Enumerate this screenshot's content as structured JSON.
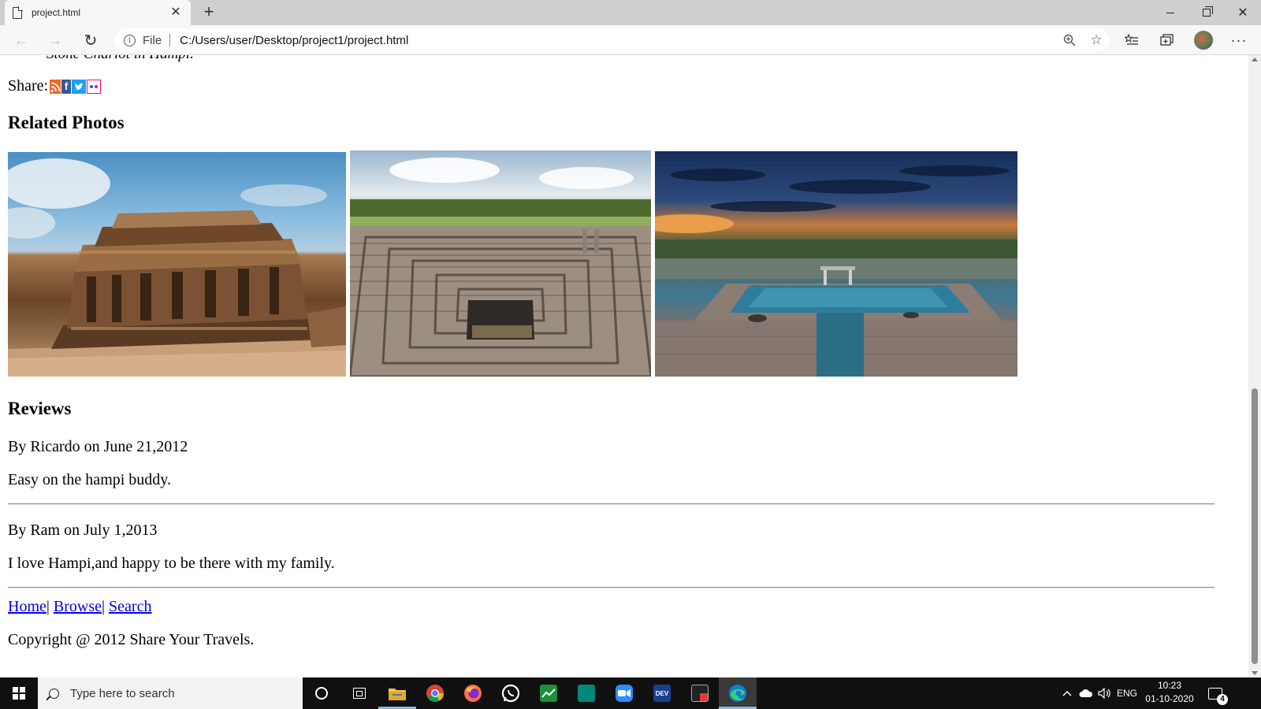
{
  "browser": {
    "tab_title": "project.html",
    "new_tab_glyph": "+",
    "close_glyph": "✕",
    "address_scheme_label": "File",
    "url": "C:/Users/user/Desktop/project1/project.html",
    "icons": [
      "back-arrow-icon",
      "forward-arrow-icon",
      "refresh-icon",
      "info-icon",
      "zoom-icon",
      "star-icon",
      "favorites-icon",
      "collections-icon",
      "profile-avatar",
      "more-icon"
    ]
  },
  "page": {
    "caption_fragment": "Stone Chariot in Hampi.",
    "share_label": "Share:",
    "share_icons": [
      "rss-icon",
      "facebook-icon",
      "twitter-icon",
      "flickr-icon"
    ],
    "related_heading": "Related Photos",
    "photos": [
      {
        "alt": "Vittala temple, Hampi"
      },
      {
        "alt": "Stepped tank, Hampi"
      },
      {
        "alt": "Pushkarani pond at sunset, Hampi"
      }
    ],
    "reviews_heading": "Reviews",
    "reviews": [
      {
        "byline": "By Ricardo on June 21,2012",
        "text": "Easy on the hampi buddy."
      },
      {
        "byline": "By Ram on July 1,2013",
        "text": "I love Hampi,and happy to be there with my family."
      }
    ],
    "footer_links": [
      "Home",
      "Browse",
      "Search"
    ],
    "footer_separator": "|",
    "copyright": "Copyright @ 2012 Share Your Travels."
  },
  "taskbar": {
    "search_placeholder": "Type here to search",
    "language": "ENG",
    "time": "10:23",
    "date": "01-10-2020",
    "notification_count": "4"
  },
  "colors": {
    "link": "#0000ee",
    "taskbar_bg": "#101010",
    "tab_strip_bg": "#cfcfcf"
  }
}
